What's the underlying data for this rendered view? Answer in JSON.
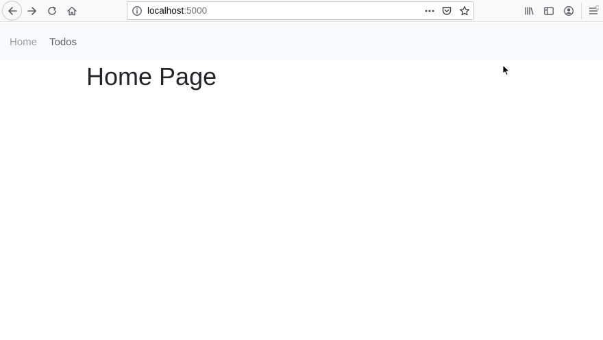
{
  "browser": {
    "url_host": "localhost",
    "url_port": ":5000",
    "icons": [
      "back-arrow-icon",
      "forward-arrow-icon",
      "reload-icon",
      "home-icon",
      "info-icon",
      "more-actions-icon",
      "pocket-icon",
      "bookmark-star-icon",
      "library-icon",
      "sidebar-icon",
      "account-icon",
      "menu-icon"
    ]
  },
  "nav": {
    "home_label": "Home",
    "todos_label": "Todos"
  },
  "main": {
    "title": "Home Page"
  },
  "colors": {
    "toolbar_bg": "#f9f9fa",
    "navbar_bg": "#f8f9fa",
    "title_text": "#212529",
    "nav_muted": "#9a9ea3",
    "nav_active": "#5d6167"
  }
}
